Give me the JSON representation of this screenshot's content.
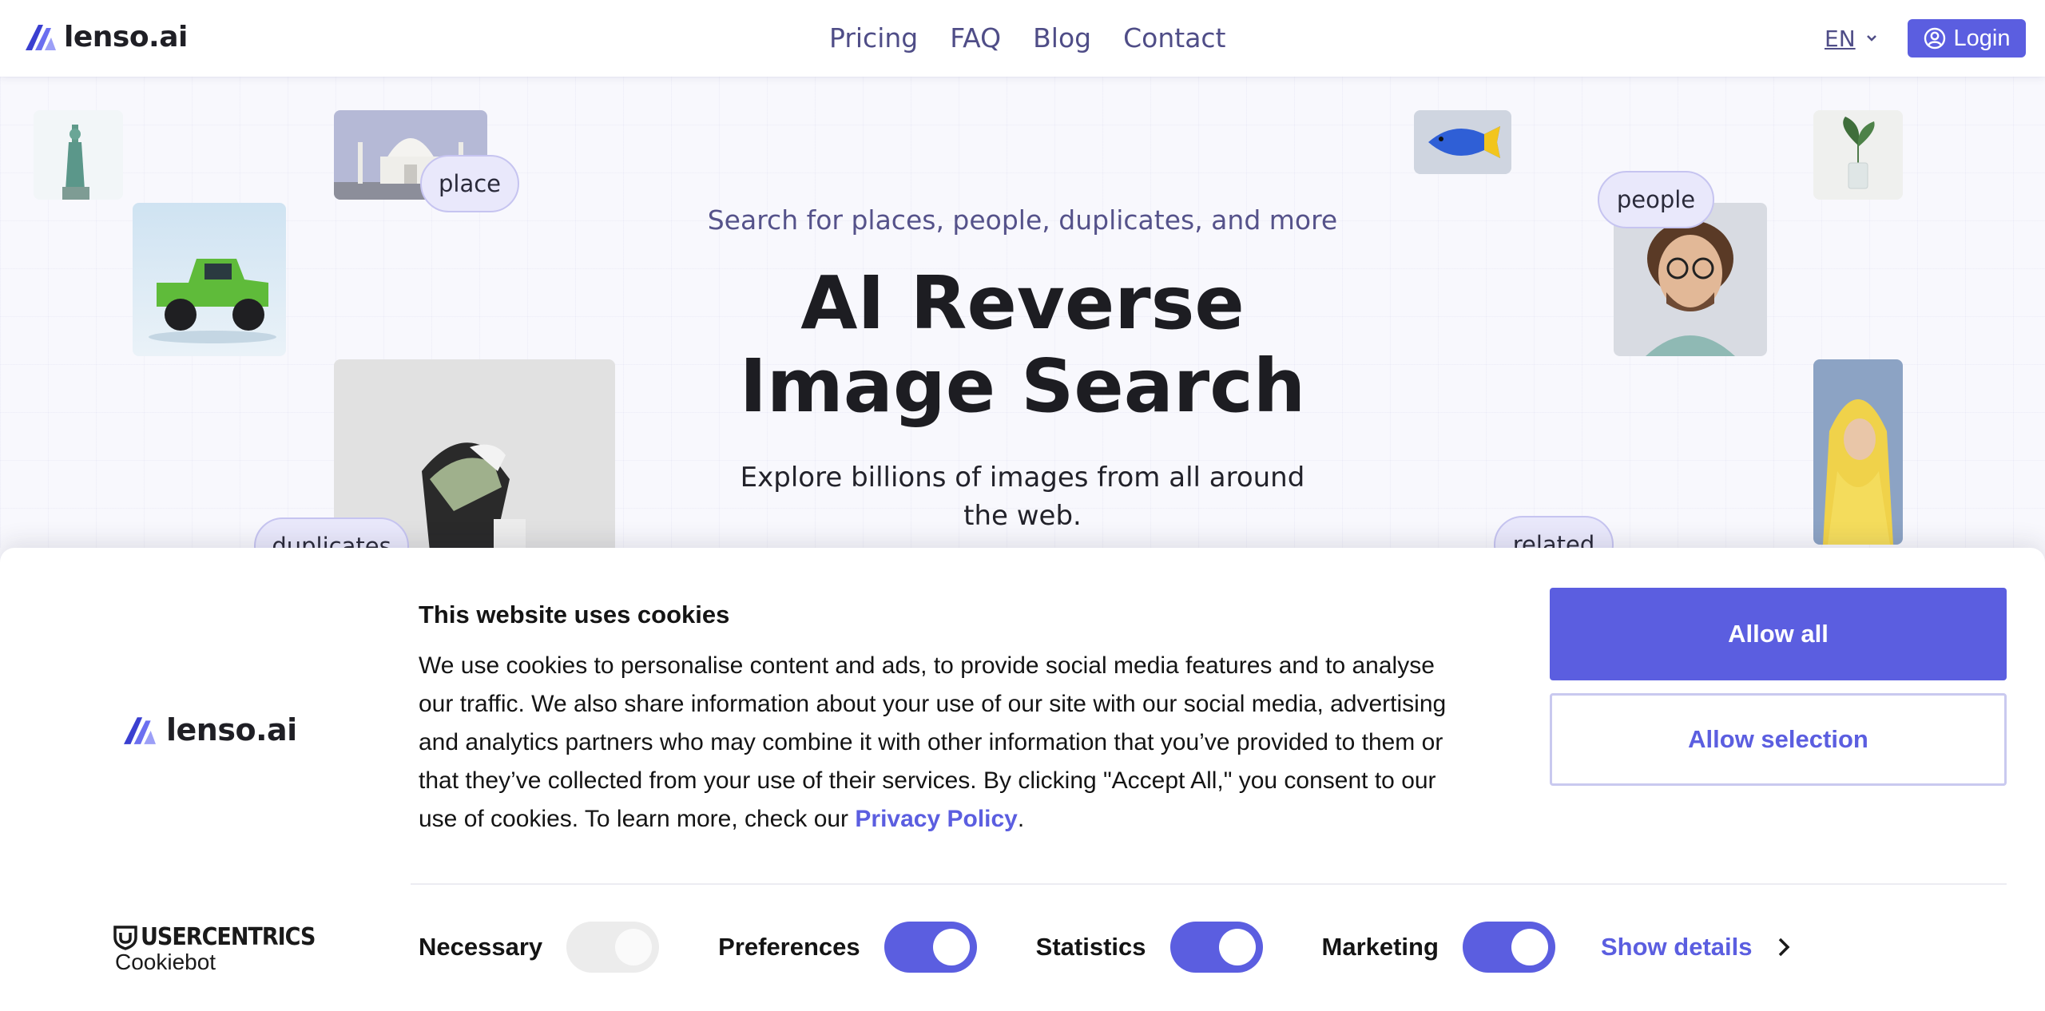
{
  "header": {
    "logo_text": "lenso.ai",
    "nav": [
      {
        "label": "Pricing"
      },
      {
        "label": "FAQ"
      },
      {
        "label": "Blog"
      },
      {
        "label": "Contact"
      }
    ],
    "language": "EN",
    "login_label": "Login"
  },
  "hero": {
    "subtitle": "Search for places, people, duplicates, and more",
    "title_line1": "AI Reverse",
    "title_line2": "Image Search",
    "description": "Explore billions of images from all around the web.",
    "chips": {
      "place": "place",
      "people": "people",
      "duplicates": "duplicates",
      "related": "related"
    }
  },
  "cookie_banner": {
    "logo_text": "lenso.ai",
    "title": "This website uses cookies",
    "body": "We use cookies to personalise content and ads, to provide social media features and to analyse our traffic. We also share information about your use of our site with our social media, advertising and analytics partners who may combine it with other information that you’ve provided to them or that they’ve collected from your use of their services. By clicking \"Accept All,\" you consent to our use of cookies. To learn more, check our ",
    "privacy_link": "Privacy Policy",
    "body_end": ".",
    "allow_all": "Allow all",
    "allow_selection": "Allow selection",
    "toggles": [
      {
        "label": "Necessary",
        "enabled": true,
        "locked": true
      },
      {
        "label": "Preferences",
        "enabled": true,
        "locked": false
      },
      {
        "label": "Statistics",
        "enabled": true,
        "locked": false
      },
      {
        "label": "Marketing",
        "enabled": true,
        "locked": false
      }
    ],
    "show_details": "Show details",
    "brand_top": "USERCENTRICS",
    "brand_bottom": "Cookiebot"
  },
  "colors": {
    "accent": "#5b5ee0",
    "nav_text": "#4f4d87",
    "chip_bg": "#e9e8fb"
  }
}
